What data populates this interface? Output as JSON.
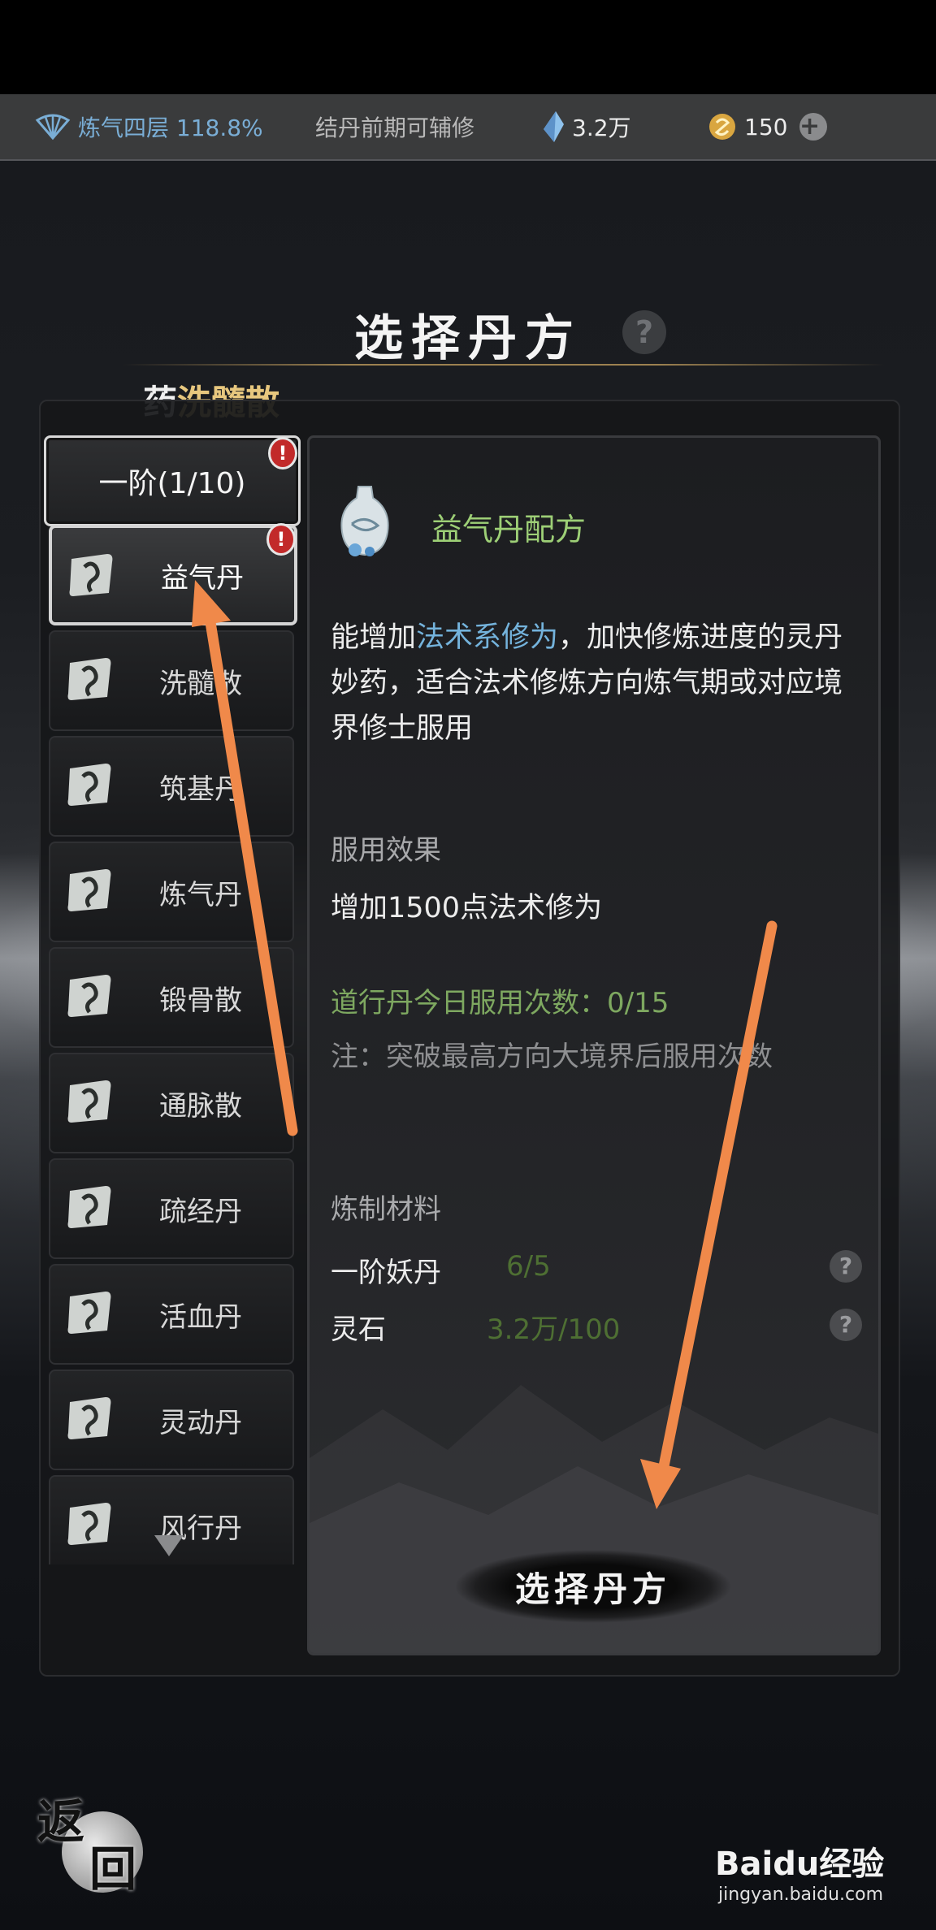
{
  "status_bar": {
    "cultivation": "炼气四层 118.8%",
    "hint": "结丹前期可辅修",
    "spirit_stone": "3.2万",
    "coins": "150",
    "plus_icon": "plus-icon"
  },
  "title": "选择丹方",
  "category": {
    "prefix": "药",
    "name": "洗髓散"
  },
  "tier": {
    "label": "一阶(1/10)",
    "badge": "!"
  },
  "recipes": [
    {
      "label": "益气丹",
      "selected": true,
      "badge": "!"
    },
    {
      "label": "洗髓散"
    },
    {
      "label": "筑基丹"
    },
    {
      "label": "炼气丹"
    },
    {
      "label": "锻骨散"
    },
    {
      "label": "通脉散"
    },
    {
      "label": "疏经丹"
    },
    {
      "label": "活血丹"
    },
    {
      "label": "灵动丹"
    },
    {
      "label": "风行丹"
    }
  ],
  "detail": {
    "title": "益气丹配方",
    "desc_pre": "能增加",
    "desc_hl": "法术系修为",
    "desc_post": "，加快修炼进度的灵丹妙药，适合法术修炼方向炼气期或对应境界修士服用",
    "effect_label": "服用效果",
    "effect_text": "增加1500点法术修为",
    "daily_use": "道行丹今日服用次数：0/15",
    "note": "注：突破最高方向大境界后服用次数",
    "materials_label": "炼制材料",
    "materials": [
      {
        "name": "一阶妖丹",
        "value": "6/5"
      },
      {
        "name": "灵石",
        "value": "3.2万/100"
      }
    ]
  },
  "choose_button": "选择丹方",
  "back_button": {
    "c1": "返",
    "c2": "回"
  },
  "watermark": {
    "brand": "Baidu经验",
    "url": "jingyan.baidu.com"
  },
  "colors": {
    "accent_gold": "#e7c77e",
    "detail_title_green": "#9dcf76",
    "highlight_blue": "#74b3dc",
    "annotation_arrow": "#f0894a"
  }
}
